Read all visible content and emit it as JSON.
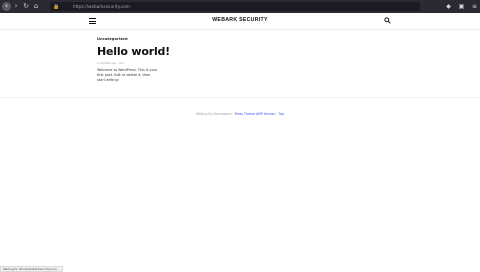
{
  "browser": {
    "url": "https://webarksecurity.com"
  },
  "header": {
    "site_title": "WEBARK SECURITY"
  },
  "post": {
    "category": "Uncategorized",
    "title": "Hello world!",
    "meta": "2 months ago · hiro",
    "body": "Welcome to WordPress. This is your first post. Edit or delete it, then start writing!"
  },
  "footer": {
    "prefix": "Writing By Developers · ",
    "link": "Press Theme AMP Version · Top"
  },
  "status": {
    "text": "Waiting for #local/webarksecurity.com..."
  },
  "colors": {
    "chrome": "#2b2a33",
    "link": "#3858e9"
  }
}
